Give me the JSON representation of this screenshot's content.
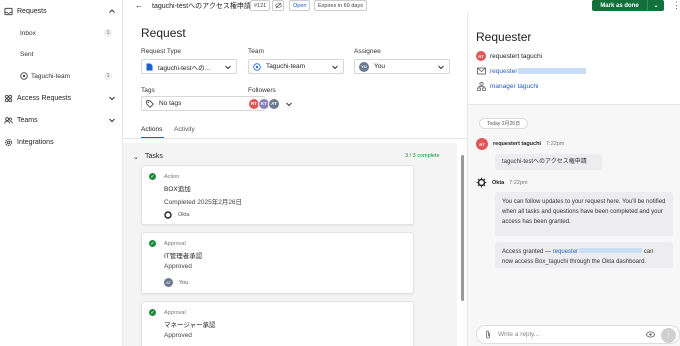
{
  "sidebar": {
    "requests_label": "Requests",
    "inbox_label": "Inbox",
    "inbox_count": "1",
    "sent_label": "Sent",
    "team_label": "Taguchi-team",
    "team_count": "1",
    "access_requests_label": "Access Requests",
    "teams_label": "Teams",
    "integrations_label": "Integrations"
  },
  "topbar": {
    "title": "taguchi-testへのアクセス権申請",
    "ticket_id": "#121",
    "status": "Open",
    "expires": "Expires in 60 days",
    "mark_done_label": "Mark as done"
  },
  "request": {
    "heading": "Request",
    "request_type_label": "Request Type",
    "request_type_value": "taguchi-testへの...",
    "team_label": "Team",
    "team_value": "Taguchi-team",
    "assignee_label": "Assignee",
    "assignee_value": "You",
    "assignee_initials": "YO",
    "tags_label": "Tags",
    "tags_value": "No tags",
    "followers_label": "Followers",
    "followers": [
      "RT",
      "KT",
      "AT"
    ]
  },
  "tabs": {
    "actions": "Actions",
    "activity": "Activity"
  },
  "tasks": {
    "heading": "Tasks",
    "complete": "3 / 3 complete",
    "items": [
      {
        "type": "Action",
        "name": "BOX追加",
        "status": "Completed 2025年2月26日",
        "person": "Okta"
      },
      {
        "type": "Approval",
        "name": "IT管理者承認",
        "status": "Approved",
        "person": "You",
        "initials": "AT"
      },
      {
        "type": "Approval",
        "name": "マネージャー承認",
        "status": "Approved"
      }
    ]
  },
  "requester": {
    "heading": "Requester",
    "name": "requestert taguchi",
    "initials": "RT",
    "email_prefix": "requester",
    "manager": "manager taguchi"
  },
  "chat": {
    "date": "Today 2月26日",
    "m1_author": "requestert taguchi",
    "m1_time": "7:22pm",
    "m1_text": "taguchi-testへのアクセス権申請",
    "m2_author": "Okta",
    "m2_time": "7:22pm",
    "m2_text": "You can follow updates to your request here. You'll be notified when all tasks and questions have been completed and your access has been granted.",
    "m3_prefix": "Access granted — ",
    "m3_link": "requester",
    "m3_suffix": "can now access Box_taguchi through the Okta dashboard.",
    "reply_placeholder": "Write a reply..."
  },
  "colors": {
    "accent": "#1d5fcc",
    "success": "#1d8b3d",
    "primary_button": "#12703a",
    "rt": "#e05656",
    "kt": "#8a7fb8",
    "at": "#6b7a91"
  }
}
